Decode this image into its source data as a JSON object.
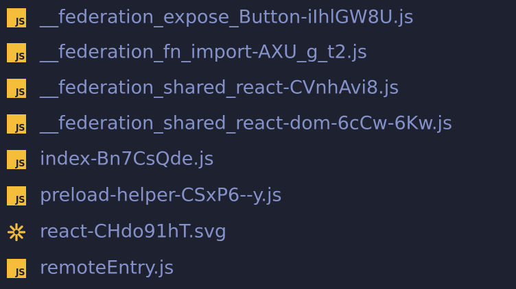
{
  "files": [
    {
      "name": "__federation_expose_Button-iIhlGW8U.js",
      "icon": "js-file-icon",
      "badge": "JS"
    },
    {
      "name": "__federation_fn_import-AXU_g_t2.js",
      "icon": "js-file-icon",
      "badge": "JS"
    },
    {
      "name": "__federation_shared_react-CVnhAvi8.js",
      "icon": "js-file-icon",
      "badge": "JS"
    },
    {
      "name": "__federation_shared_react-dom-6cCw-6Kw.js",
      "icon": "js-file-icon",
      "badge": "JS"
    },
    {
      "name": "index-Bn7CsQde.js",
      "icon": "js-file-icon",
      "badge": "JS"
    },
    {
      "name": "preload-helper-CSxP6--y.js",
      "icon": "js-file-icon",
      "badge": "JS"
    },
    {
      "name": "react-CHdo91hT.svg",
      "icon": "svg-file-icon",
      "badge": ""
    },
    {
      "name": "remoteEntry.js",
      "icon": "js-file-icon",
      "badge": "JS"
    }
  ],
  "colors": {
    "background": "#1e2130",
    "text": "#8592c9",
    "js_badge": "#f5be3a",
    "svg_icon": "#f5be3a"
  }
}
